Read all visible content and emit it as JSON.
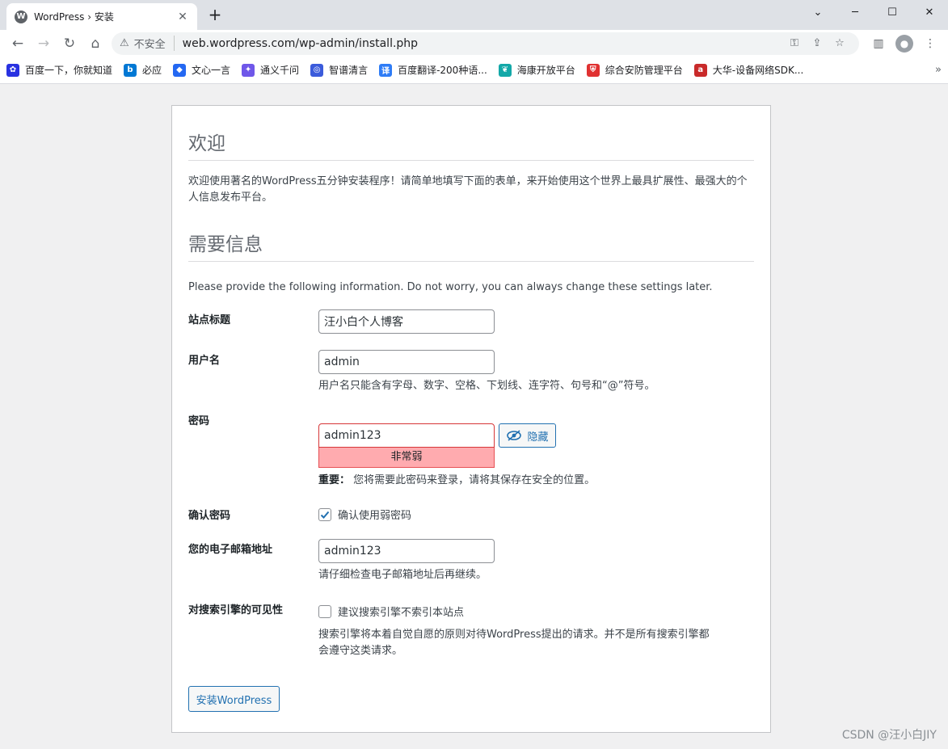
{
  "browser": {
    "tab_title": "WordPress › 安装",
    "favicon_letter": "W",
    "not_secure": "不安全",
    "url": "web.wordpress.com/wp-admin/install.php"
  },
  "bookmarks": [
    {
      "label": "百度一下，你就知道",
      "icon": "paw",
      "color": "#2932e1"
    },
    {
      "label": "必应",
      "icon": "b",
      "color": "#0078d4"
    },
    {
      "label": "文心一言",
      "icon": "cube",
      "color": "#2468f2"
    },
    {
      "label": "通义千问",
      "icon": "star",
      "color": "#6f57e9"
    },
    {
      "label": "智谱清言",
      "icon": "ring",
      "color": "#3b5bdb"
    },
    {
      "label": "百度翻译-200种语...",
      "icon": "译",
      "color": "#2e7cf6"
    },
    {
      "label": "海康开放平台",
      "icon": "leaf",
      "color": "#13a8a8"
    },
    {
      "label": "综合安防管理平台",
      "icon": "shield",
      "color": "#e03131"
    },
    {
      "label": "大华-设备网络SDK...",
      "icon": "a",
      "color": "#c92a2a"
    }
  ],
  "page": {
    "welcome_title": "欢迎",
    "welcome_text": "欢迎使用著名的WordPress五分钟安装程序！请简单地填写下面的表单，来开始使用这个世界上最具扩展性、最强大的个人信息发布平台。",
    "info_title": "需要信息",
    "info_text": "Please provide the following information. Do not worry, you can always change these settings later.",
    "site_title_label": "站点标题",
    "site_title_value": "汪小白个人博客",
    "username_label": "用户名",
    "username_value": "admin",
    "username_hint": "用户名只能含有字母、数字、空格、下划线、连字符、句号和“@”符号。",
    "password_label": "密码",
    "password_value": "admin123",
    "hide_button": "隐藏",
    "strength": "非常弱",
    "important_label": "重要：",
    "important_text": "您将需要此密码来登录，请将其保存在安全的位置。",
    "confirm_label": "确认密码",
    "confirm_checkbox": "确认使用弱密码",
    "email_label": "您的电子邮箱地址",
    "email_value": "admin123",
    "email_hint": "请仔细检查电子邮箱地址后再继续。",
    "visibility_label": "对搜索引擎的可见性",
    "visibility_checkbox": "建议搜索引擎不索引本站点",
    "visibility_hint_1": "搜索引擎将本着自觉自愿的原则对待WordPress提出的请求。并不是所有搜索引擎都",
    "visibility_hint_2": "会遵守这类请求。",
    "install_button": "安装WordPress"
  },
  "watermark": "CSDN @汪小白JIY"
}
